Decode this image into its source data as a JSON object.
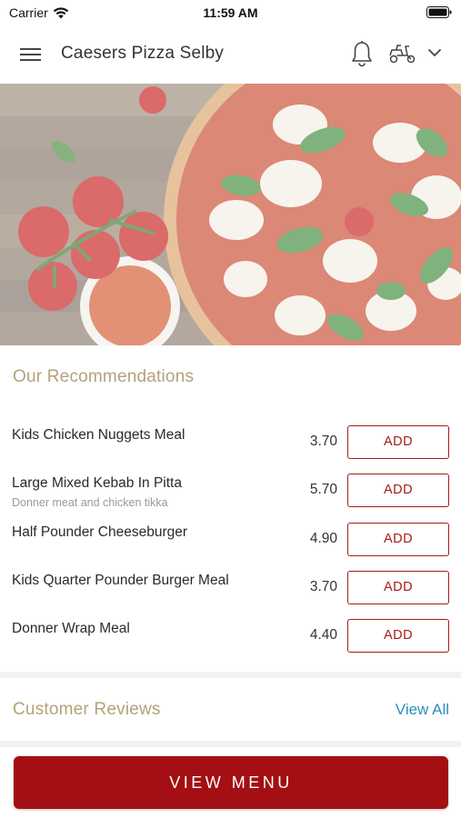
{
  "status_bar": {
    "carrier": "Carrier",
    "time": "11:59 AM"
  },
  "header": {
    "title": "Caesers Pizza Selby",
    "icons": [
      "menu-icon",
      "bell-icon",
      "scooter-icon",
      "chevron-down-icon"
    ]
  },
  "recommendations": {
    "title": "Our Recommendations",
    "items": [
      {
        "name": "Kids Chicken Nuggets Meal",
        "description": "",
        "price": "3.70",
        "button": "ADD"
      },
      {
        "name": "Large Mixed Kebab In Pitta",
        "description": "Donner meat and chicken tikka",
        "price": "5.70",
        "button": "ADD"
      },
      {
        "name": "Half Pounder Cheeseburger",
        "description": "",
        "price": "4.90",
        "button": "ADD"
      },
      {
        "name": "Kids Quarter Pounder Burger Meal",
        "description": "",
        "price": "3.70",
        "button": "ADD"
      },
      {
        "name": "Donner Wrap Meal",
        "description": "",
        "price": "4.40",
        "button": "ADD"
      }
    ]
  },
  "reviews": {
    "title": "Customer Reviews",
    "view_all": "View All"
  },
  "footer": {
    "view_menu": "VIEW MENU"
  },
  "colors": {
    "accent": "#a30f12",
    "section_title": "#b3a27a",
    "link": "#2a8fc0"
  }
}
